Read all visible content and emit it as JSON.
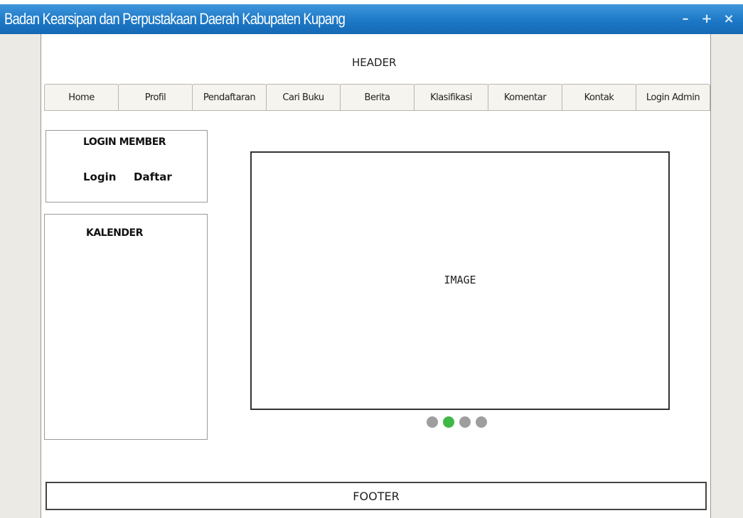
{
  "window": {
    "title": "Badan Kearsipan dan Perpustakaan Daerah Kabupaten Kupang",
    "controls": {
      "minimize": "–",
      "maximize": "+",
      "close": "×"
    }
  },
  "header": {
    "label": "HEADER"
  },
  "nav": {
    "tabs": [
      "Home",
      "Profil",
      "Pendaftaran",
      "Cari Buku",
      "Berita",
      "Klasifikasi",
      "Komentar",
      "Kontak",
      "Login Admin"
    ]
  },
  "login_member": {
    "title": "LOGIN MEMBER",
    "login_label": "Login",
    "daftar_label": "Daftar"
  },
  "calendar": {
    "title": "KALENDER"
  },
  "slider": {
    "image_label": "IMAGE",
    "dot_count": 4,
    "active_index": 1,
    "colors": {
      "active": "#3fb845",
      "inactive": "#9e9e9e"
    }
  },
  "footer": {
    "label": "FOOTER"
  },
  "colors": {
    "titlebar": "#1d78c6",
    "tab_bg": "#f6f4ee"
  }
}
